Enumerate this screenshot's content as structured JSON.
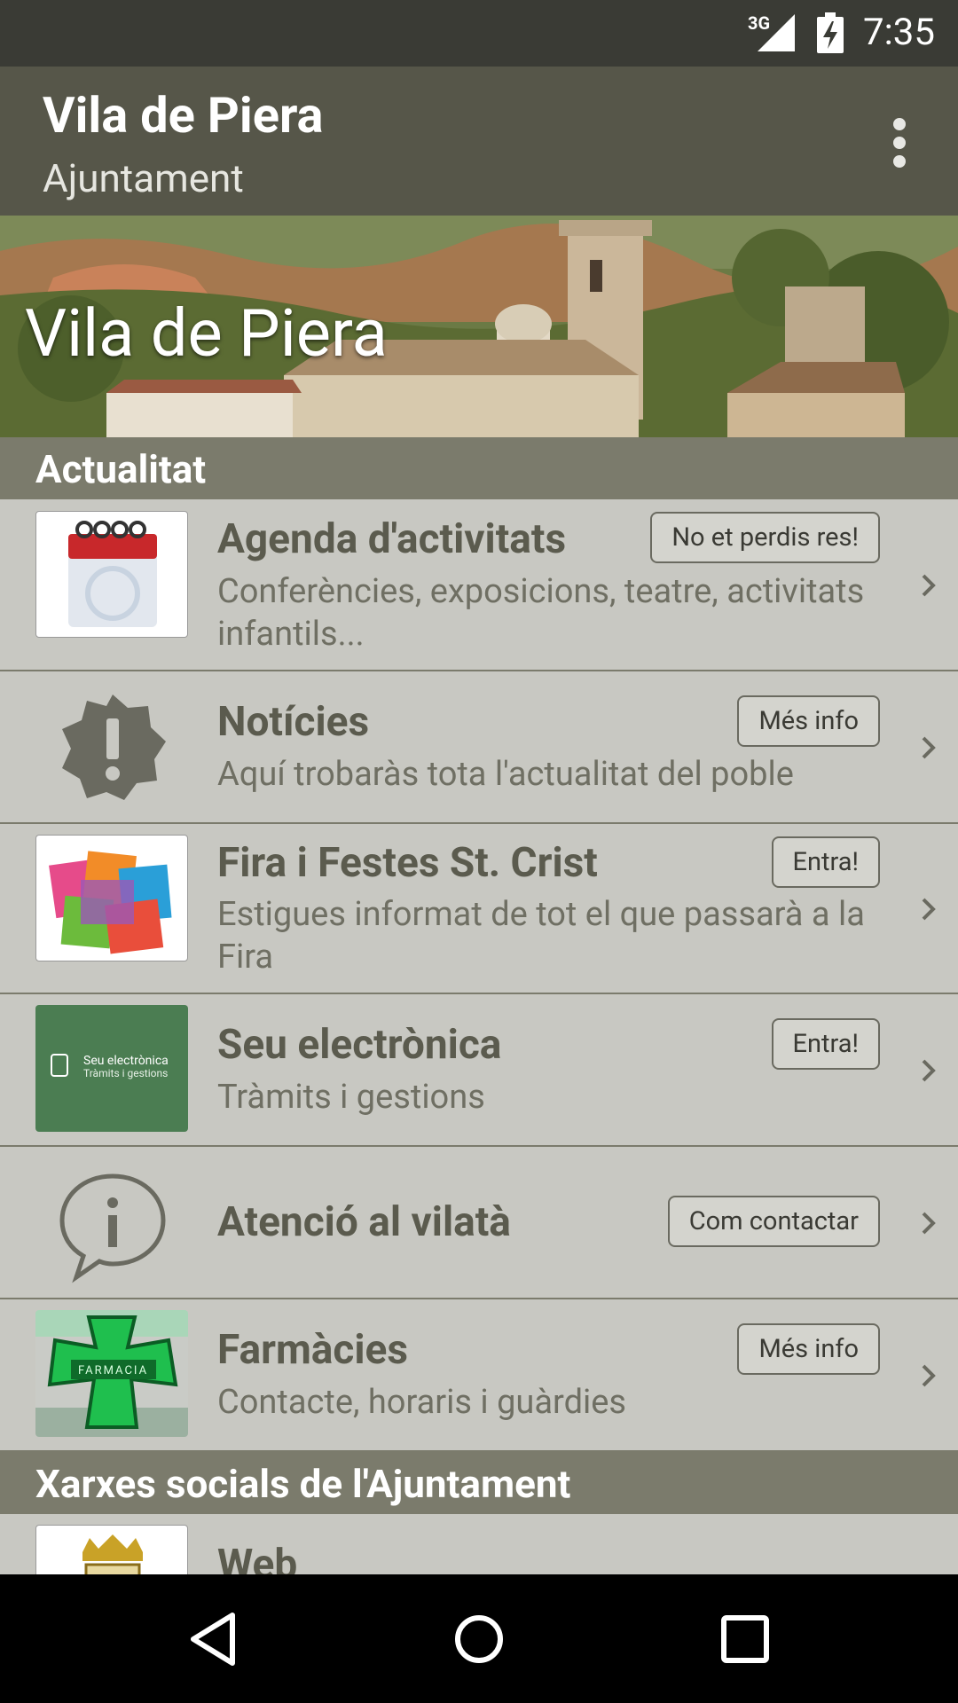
{
  "status": {
    "network": "3G",
    "time": "7:35"
  },
  "appbar": {
    "title": "Vila de Piera",
    "subtitle": "Ajuntament"
  },
  "hero": {
    "title": "Vila de Piera"
  },
  "sections": [
    {
      "label": "Actualitat"
    },
    {
      "label": "Xarxes socials de l'Ajuntament"
    }
  ],
  "items": [
    {
      "title": "Agenda d'activitats",
      "desc": "Conferències, exposicions, teatre, activitats infantils...",
      "button": "No et perdis res!",
      "icon": "calendar-image"
    },
    {
      "title": "Notícies",
      "desc": "Aquí trobaràs tota l'actualitat del poble",
      "button": "Més info",
      "icon": "alert-badge-icon"
    },
    {
      "title": "Fira i Festes St. Crist",
      "desc": "Estigues informat de tot el que passarà a la Fira",
      "button": "Entra!",
      "icon": "fira-image"
    },
    {
      "title": "Seu electrònica",
      "desc": "Tràmits i gestions",
      "button": "Entra!",
      "icon": "seu-electronica-image",
      "thumb_text": "Seu electrònica",
      "thumb_subtext": "Tràmits i gestions"
    },
    {
      "title": "Atenció al vilatà",
      "desc": "",
      "button": "Com contactar",
      "icon": "info-bubble-icon"
    },
    {
      "title": "Farmàcies",
      "desc": "Contacte, horaris i guàrdies",
      "button": "Més info",
      "icon": "pharmacy-image",
      "thumb_text": "FARMACIA"
    },
    {
      "title": "Web",
      "desc": "",
      "button": "",
      "icon": "crest-image"
    }
  ],
  "colors": {
    "appbar": "#565649",
    "section": "#7b7b6c",
    "background": "#c8c8c2",
    "status": "#3a3b35"
  }
}
